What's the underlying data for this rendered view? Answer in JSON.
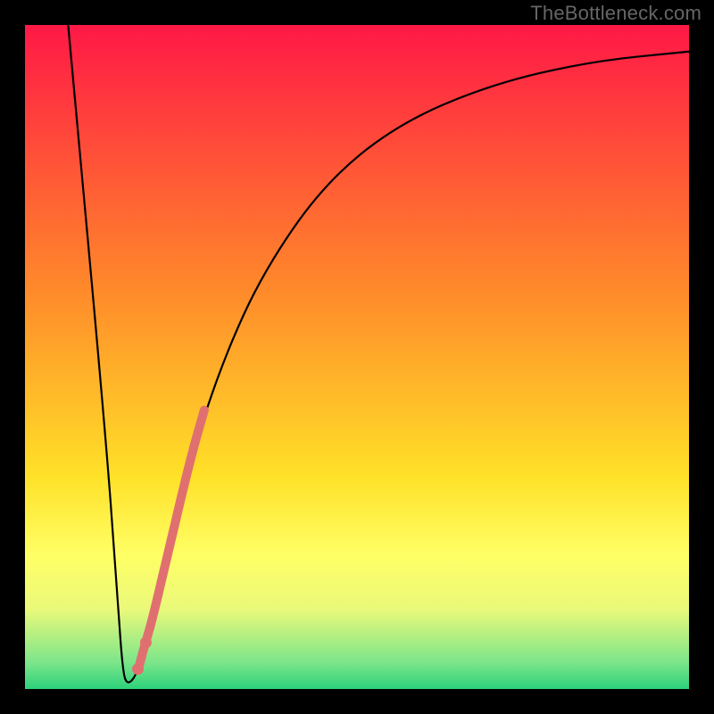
{
  "watermark": "TheBottleneck.com",
  "chart_data": {
    "type": "line",
    "title": "",
    "xlabel": "",
    "ylabel": "",
    "xlim": [
      0,
      100
    ],
    "ylim": [
      0,
      100
    ],
    "grid": false,
    "legend": false,
    "gradient_stops": [
      {
        "offset": 0,
        "color": "#ff1846"
      },
      {
        "offset": 40,
        "color": "#ff8a2a"
      },
      {
        "offset": 68,
        "color": "#ffe128"
      },
      {
        "offset": 80,
        "color": "#ffff66"
      },
      {
        "offset": 88,
        "color": "#eaf97a"
      },
      {
        "offset": 96,
        "color": "#7ce58a"
      },
      {
        "offset": 100,
        "color": "#2cd27b"
      }
    ],
    "series": [
      {
        "name": "bottleneck-curve",
        "type": "line",
        "color": "#000000",
        "points": [
          {
            "x": 6.5,
            "y": 100
          },
          {
            "x": 12.0,
            "y": 40
          },
          {
            "x": 13.8,
            "y": 16
          },
          {
            "x": 14.7,
            "y": 2.5
          },
          {
            "x": 15.5,
            "y": 0.5
          },
          {
            "x": 17.0,
            "y": 2.5
          },
          {
            "x": 19.0,
            "y": 10
          },
          {
            "x": 22.0,
            "y": 22
          },
          {
            "x": 25.0,
            "y": 35
          },
          {
            "x": 30.0,
            "y": 50
          },
          {
            "x": 36.0,
            "y": 63
          },
          {
            "x": 45.0,
            "y": 76
          },
          {
            "x": 56.0,
            "y": 85
          },
          {
            "x": 70.0,
            "y": 91
          },
          {
            "x": 85.0,
            "y": 94.5
          },
          {
            "x": 100.0,
            "y": 96
          }
        ]
      },
      {
        "name": "highlight-segment",
        "type": "line",
        "color": "#e07070",
        "width": 10,
        "points": [
          {
            "x": 17.2,
            "y": 3.5
          },
          {
            "x": 18.0,
            "y": 6.5
          },
          {
            "x": 19.2,
            "y": 10.5
          },
          {
            "x": 22.0,
            "y": 22.5
          },
          {
            "x": 25.0,
            "y": 35.0
          },
          {
            "x": 27.0,
            "y": 42.0
          }
        ]
      },
      {
        "name": "highlight-dots",
        "type": "scatter",
        "color": "#e07070",
        "points": [
          {
            "x": 17.0,
            "y": 3.0
          },
          {
            "x": 18.2,
            "y": 7.0
          }
        ]
      }
    ]
  }
}
